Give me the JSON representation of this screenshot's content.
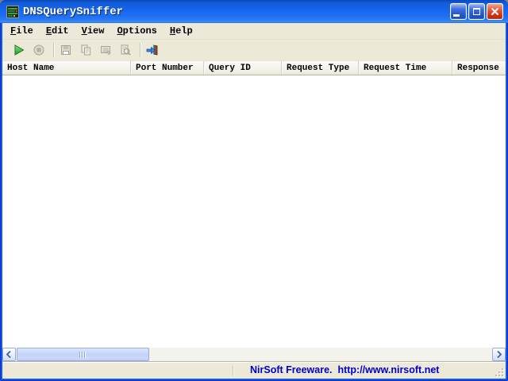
{
  "window": {
    "title": "DNSQuerySniffer",
    "app_icon": "sniffer-monitor-icon",
    "controls": [
      "minimize",
      "maximize",
      "close"
    ]
  },
  "menu": {
    "items": [
      "File",
      "Edit",
      "View",
      "Options",
      "Help"
    ]
  },
  "toolbar": {
    "buttons": [
      {
        "icon": "start-capture-icon",
        "enabled": true
      },
      {
        "icon": "stop-capture-icon",
        "enabled": false
      },
      {
        "icon": "save-icon",
        "enabled": false
      },
      {
        "icon": "copy-icon",
        "enabled": false
      },
      {
        "icon": "properties-icon",
        "enabled": false
      },
      {
        "icon": "find-icon",
        "enabled": false
      },
      {
        "icon": "exit-icon",
        "enabled": true
      }
    ]
  },
  "listview": {
    "columns": [
      {
        "label": "Host Name"
      },
      {
        "label": "Port Number"
      },
      {
        "label": "Query ID"
      },
      {
        "label": "Request Type"
      },
      {
        "label": "Request Time"
      },
      {
        "label": "Response"
      }
    ],
    "rows": []
  },
  "statusbar": {
    "text": "NirSoft Freeware.  http://www.nirsoft.net"
  },
  "colors": {
    "titlebar_blue": "#1766EF",
    "window_border_blue": "#1857E2",
    "client_beige": "#ECE9D8",
    "status_link_blue": "#0000CC",
    "play_green": "#2FA832",
    "close_red": "#CE3413",
    "scroll_thumb_blue": "#C3D3F8"
  }
}
